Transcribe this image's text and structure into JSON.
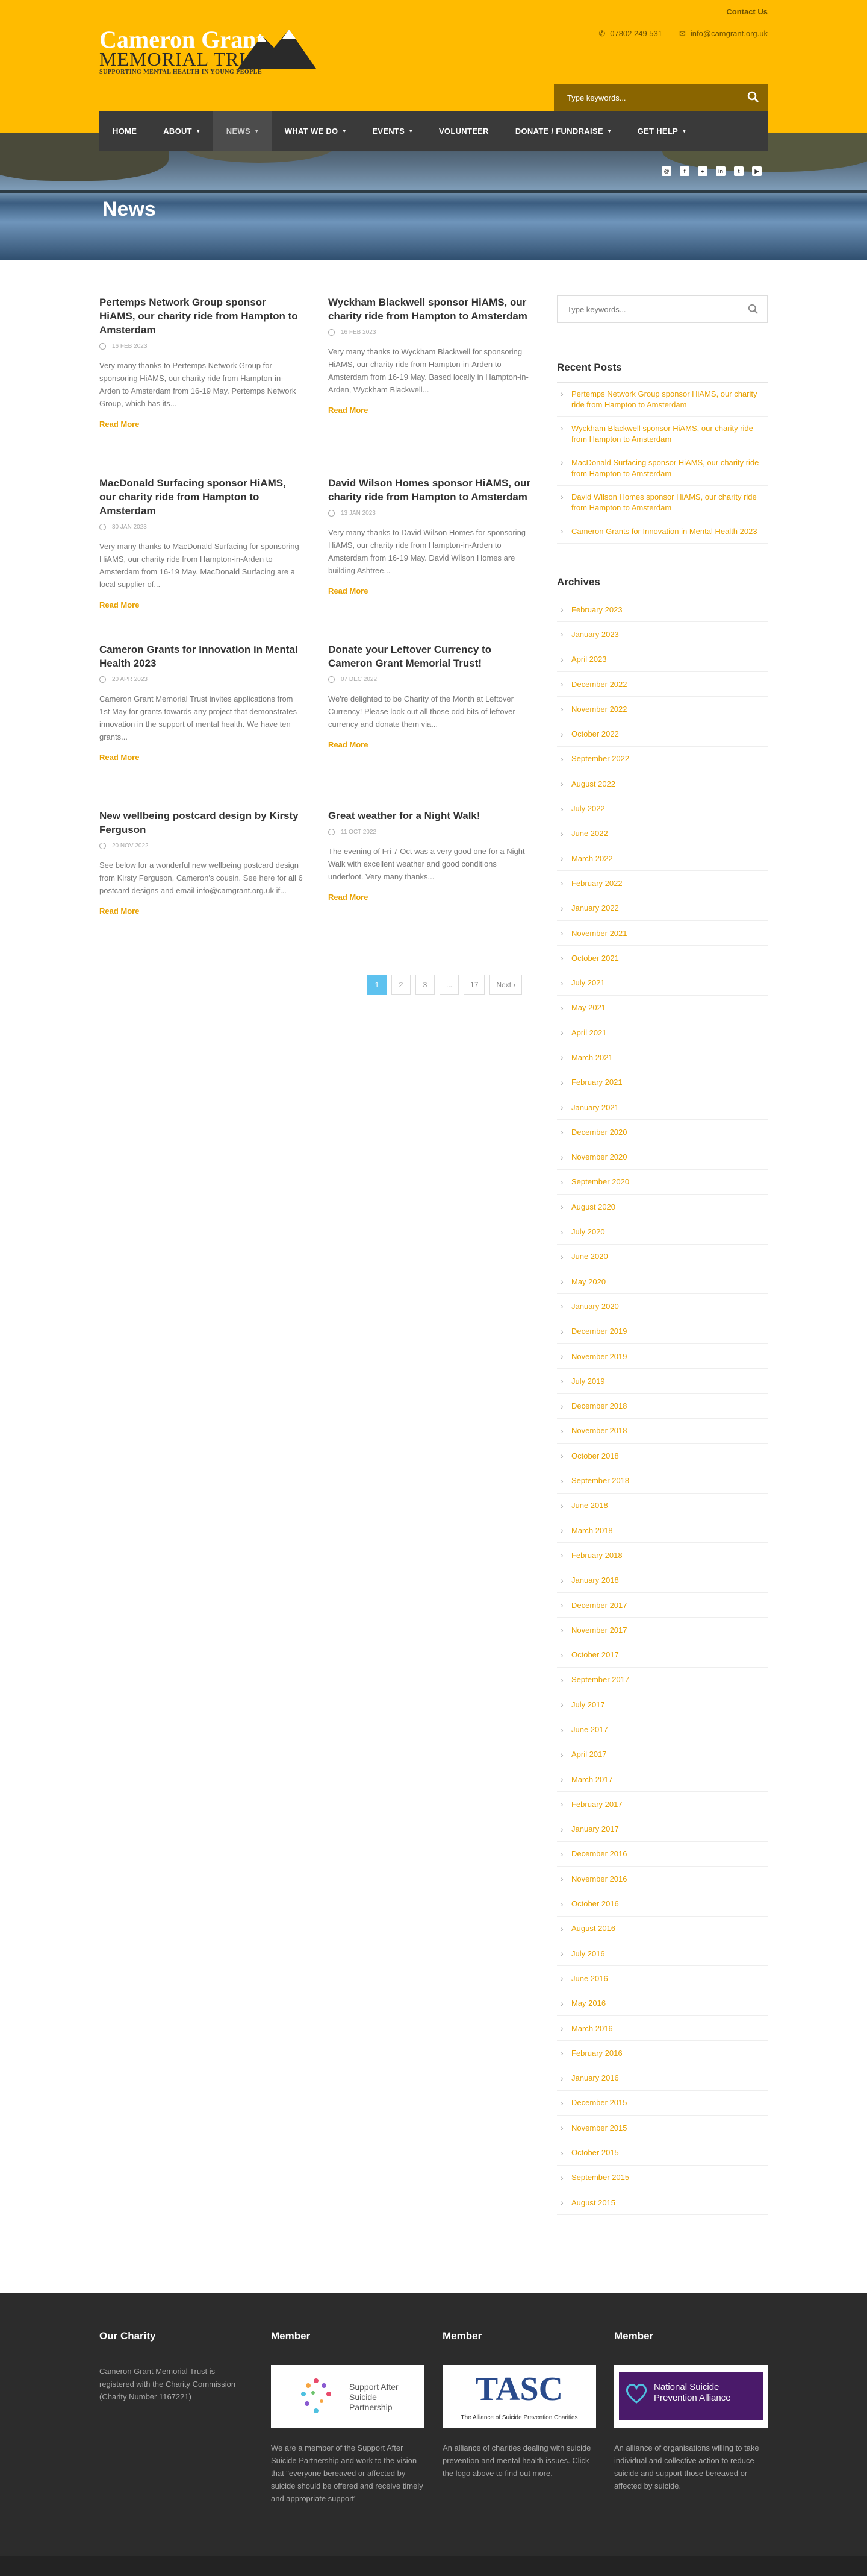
{
  "header": {
    "contact_label": "Contact Us",
    "phone": "07802 249 531",
    "email": "info@camgrant.org.uk",
    "logo": {
      "line1": "Cameron Grant",
      "line2": "MEMORIAL TRUST",
      "line3": "SUPPORTING MENTAL HEALTH IN YOUNG PEOPLE"
    },
    "search_placeholder": "Type keywords...",
    "brand_color": "#ffbb00"
  },
  "nav": {
    "items": [
      {
        "label": "HOME",
        "has_caret": false
      },
      {
        "label": "ABOUT",
        "has_caret": true
      },
      {
        "label": "NEWS",
        "has_caret": true
      },
      {
        "label": "WHAT WE DO",
        "has_caret": true
      },
      {
        "label": "EVENTS",
        "has_caret": true
      },
      {
        "label": "VOLUNTEER",
        "has_caret": false
      },
      {
        "label": "DONATE / FUNDRAISE",
        "has_caret": true
      },
      {
        "label": "GET HELP",
        "has_caret": true
      }
    ],
    "caret": "▾"
  },
  "hero": {
    "title": "News"
  },
  "posts": [
    {
      "title": "Pertemps Network Group sponsor HiAMS, our charity ride from Hampton to Amsterdam",
      "date": "16 FEB 2023",
      "excerpt": "Very many thanks to Pertemps Network Group for sponsoring HiAMS, our charity ride from Hampton-in-Arden to Amsterdam from 16-19 May. Pertemps Network Group, which has its...",
      "more": "Read More"
    },
    {
      "title": "Wyckham Blackwell sponsor HiAMS, our charity ride from Hampton to Amsterdam",
      "date": "16 FEB 2023",
      "excerpt": "Very many thanks to Wyckham Blackwell for sponsoring HiAMS, our charity ride from Hampton-in-Arden to Amsterdam from 16-19 May. Based locally in Hampton-in-Arden, Wyckham Blackwell...",
      "more": "Read More"
    },
    {
      "title": "MacDonald Surfacing sponsor HiAMS, our charity ride from Hampton to Amsterdam",
      "date": "30 JAN 2023",
      "excerpt": "Very many thanks to MacDonald Surfacing for sponsoring HiAMS, our charity ride from Hampton-in-Arden to Amsterdam from 16-19 May. MacDonald Surfacing are a local supplier of...",
      "more": "Read More"
    },
    {
      "title": "David Wilson Homes sponsor HiAMS, our charity ride from Hampton to Amsterdam",
      "date": "13 JAN 2023",
      "excerpt": "Very many thanks to David Wilson Homes for sponsoring HiAMS, our charity ride from Hampton-in-Arden to Amsterdam from 16-19 May. David Wilson Homes are building Ashtree...",
      "more": "Read More"
    },
    {
      "title": "Cameron Grants for Innovation in Mental Health 2023",
      "date": "20 APR 2023",
      "excerpt": "Cameron Grant Memorial Trust invites applications from 1st May for grants towards any project that demonstrates innovation in the support of mental health. We have ten grants...",
      "more": "Read More"
    },
    {
      "title": "Donate your Leftover Currency to Cameron Grant Memorial Trust!",
      "date": "07 DEC 2022",
      "excerpt": "We're delighted to be Charity of the Month at Leftover Currency! Please look out all those odd bits of leftover currency and donate them via...",
      "more": "Read More"
    },
    {
      "title": "New wellbeing postcard design by Kirsty Ferguson",
      "date": "20 NOV 2022",
      "excerpt": "See below for a wonderful new wellbeing postcard design from Kirsty Ferguson, Cameron's cousin. See here for all 6 postcard designs and email info@camgrant.org.uk if...",
      "more": "Read More"
    },
    {
      "title": "Great weather for a Night Walk!",
      "date": "11 OCT 2022",
      "excerpt": "The evening of Fri 7 Oct was a very good one for a Night Walk with excellent weather and good conditions underfoot. Very many thanks...",
      "more": "Read More"
    }
  ],
  "pagination": {
    "pages": [
      "1",
      "2",
      "3",
      "...",
      "17"
    ],
    "next": "Next ›"
  },
  "sidebar": {
    "search_placeholder": "Type keywords...",
    "recent_heading": "Recent Posts",
    "recent": [
      "Pertemps Network Group sponsor HiAMS, our charity ride from Hampton to Amsterdam",
      "Wyckham Blackwell sponsor HiAMS, our charity ride from Hampton to Amsterdam",
      "MacDonald Surfacing sponsor HiAMS, our charity ride from Hampton to Amsterdam",
      "David Wilson Homes sponsor HiAMS, our charity ride from Hampton to Amsterdam",
      "Cameron Grants for Innovation in Mental Health 2023"
    ],
    "archives_heading": "Archives",
    "archives": [
      "February 2023",
      "January 2023",
      "April 2023",
      "December 2022",
      "November 2022",
      "October 2022",
      "September 2022",
      "August 2022",
      "July 2022",
      "June 2022",
      "March 2022",
      "February 2022",
      "January 2022",
      "November 2021",
      "October 2021",
      "July 2021",
      "May 2021",
      "April 2021",
      "March 2021",
      "February 2021",
      "January 2021",
      "December 2020",
      "November 2020",
      "September 2020",
      "August 2020",
      "July 2020",
      "June 2020",
      "May 2020",
      "January 2020",
      "December 2019",
      "November 2019",
      "July 2019",
      "December 2018",
      "November 2018",
      "October 2018",
      "September 2018",
      "June 2018",
      "March 2018",
      "February 2018",
      "January 2018",
      "December 2017",
      "November 2017",
      "October 2017",
      "September 2017",
      "July 2017",
      "June 2017",
      "April 2017",
      "March 2017",
      "February 2017",
      "January 2017",
      "December 2016",
      "November 2016",
      "October 2016",
      "August 2016",
      "July 2016",
      "June 2016",
      "May 2016",
      "March 2016",
      "February 2016",
      "January 2016",
      "December 2015",
      "November 2015",
      "October 2015",
      "September 2015",
      "August 2015"
    ]
  },
  "footer": {
    "col1": {
      "heading": "Our Charity",
      "text": "Cameron Grant Memorial Trust is registered with the Charity Commission (Charity Number 1167221)"
    },
    "col2": {
      "heading": "Member",
      "logo_text": "Support After Suicide Partnership",
      "text": "We are a member of the Support After Suicide Partnership and work to the vision that \"everyone bereaved or affected by suicide should be offered and receive timely and appropriate support\""
    },
    "col3": {
      "heading": "Member",
      "logo_text": "TASC",
      "logo_sub": "The Alliance of Suicide Prevention Charities",
      "text": "An alliance of charities dealing with suicide prevention and mental health issues. Click the logo above to find out more."
    },
    "col4": {
      "heading": "Member",
      "logo_text": "National Suicide Prevention Alliance",
      "text": "An alliance of organisations willing to take individual and collective action to reduce suicide and support those bereaved or affected by suicide."
    }
  }
}
